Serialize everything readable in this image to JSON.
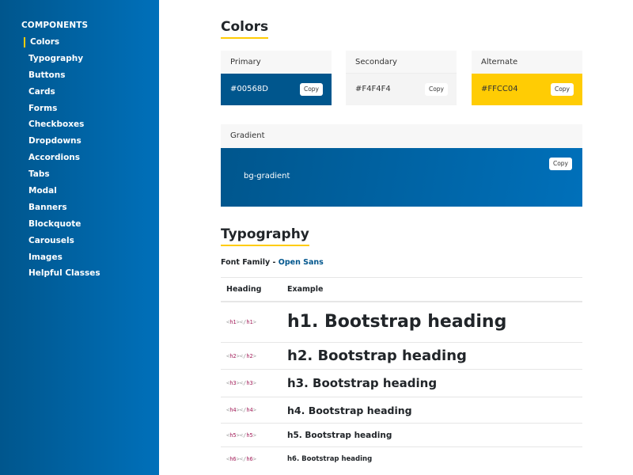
{
  "sidebar": {
    "section_title": "COMPONENTS",
    "active_item": "Colors",
    "accent_color": "#FFCC04",
    "items": [
      {
        "label": "Colors",
        "active": true
      },
      {
        "label": "Typography"
      },
      {
        "label": "Buttons"
      },
      {
        "label": "Cards"
      },
      {
        "label": "Forms"
      },
      {
        "label": "Checkboxes"
      },
      {
        "label": "Dropdowns"
      },
      {
        "label": "Accordions"
      },
      {
        "label": "Tabs"
      },
      {
        "label": "Modal"
      },
      {
        "label": "Banners"
      },
      {
        "label": "Blockquote"
      },
      {
        "label": "Carousels"
      },
      {
        "label": "Images"
      },
      {
        "label": "Helpful Classes"
      }
    ]
  },
  "colors_section": {
    "title": "Colors",
    "swatches": [
      {
        "name": "Primary",
        "hex": "#00568D",
        "copy_label": "Copy"
      },
      {
        "name": "Secondary",
        "hex": "#F4F4F4",
        "copy_label": "Copy"
      },
      {
        "name": "Alternate",
        "hex": "#FFCC04",
        "copy_label": "Copy"
      }
    ],
    "gradient": {
      "name": "Gradient",
      "class_name": "bg-gradient",
      "copy_label": "Copy"
    }
  },
  "typography_section": {
    "title": "Typography",
    "font_family_label": "Font Family",
    "font_family_separator": " - ",
    "font_family_value": "Open Sans",
    "table": {
      "headers": [
        "Heading",
        "Example"
      ],
      "rows": [
        {
          "tag": "h1",
          "example": "h1. Bootstrap heading"
        },
        {
          "tag": "h2",
          "example": "h2. Bootstrap heading"
        },
        {
          "tag": "h3",
          "example": "h3. Bootstrap heading"
        },
        {
          "tag": "h4",
          "example": "h4. Bootstrap heading"
        },
        {
          "tag": "h5",
          "example": "h5. Bootstrap heading"
        },
        {
          "tag": "h6",
          "example": "h6. Bootstrap heading"
        }
      ]
    }
  }
}
